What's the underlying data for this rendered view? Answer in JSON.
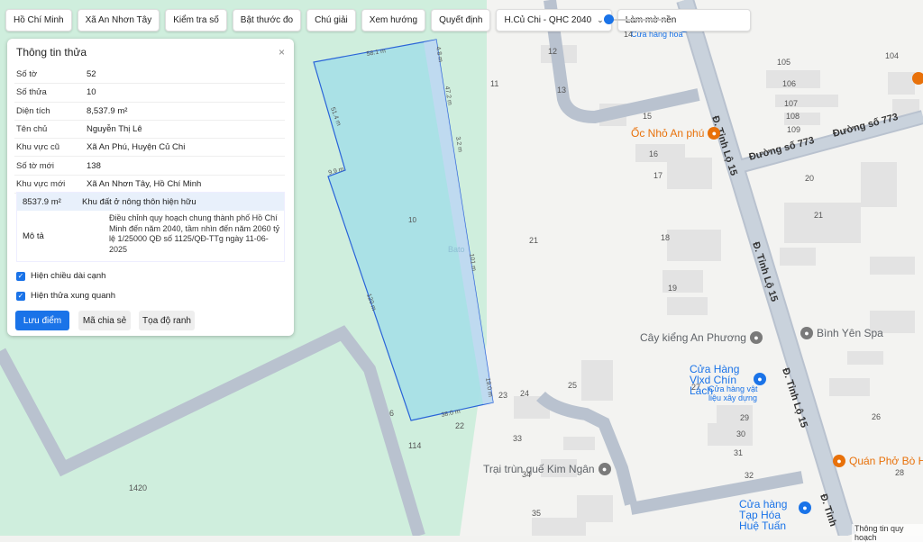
{
  "toolbar": {
    "items": [
      {
        "label": "Hồ Chí Minh"
      },
      {
        "label": "Xã An Nhơn Tây"
      },
      {
        "label": "Kiểm tra số"
      },
      {
        "label": "Bật thước đo"
      },
      {
        "label": "Chú giải"
      },
      {
        "label": "Xem hướng"
      },
      {
        "label": "Quyết định"
      },
      {
        "label": "H.Củ Chi - QHC 2040"
      },
      {
        "label": "Làm mờ nền"
      }
    ]
  },
  "panel": {
    "title": "Thông tin thửa",
    "close": "×",
    "rows": [
      {
        "key": "Số tờ",
        "value": "52"
      },
      {
        "key": "Số thửa",
        "value": "10"
      },
      {
        "key": "Diện tích",
        "value": "8,537.9 m²"
      },
      {
        "key": "Tên chủ",
        "value": "Nguyễn Thị Lê"
      },
      {
        "key": "Khu vực cũ",
        "value": "Xã An Phú, Huyện Củ Chi"
      },
      {
        "key": "Số tờ mới",
        "value": "138"
      },
      {
        "key": "Khu vực mới",
        "value": "Xã An Nhơn Tây, Hồ Chí Minh"
      }
    ],
    "land": {
      "area": "8537.9 m²",
      "type": "Khu đất ở nông thôn hiện hữu",
      "desc_label": "Mô tả",
      "desc": "Điều chỉnh quy hoạch chung thành phố Hồ Chí Minh đến năm 2040, tầm nhìn đến năm 2060 tỷ lệ 1/25000 QĐ số 1125/QĐ-TTg ngày 11-06-2025"
    },
    "checks": [
      {
        "label": "Hiện chiều dài cạnh"
      },
      {
        "label": "Hiện thửa xung quanh"
      }
    ],
    "buttons": {
      "save": "Lưu điểm",
      "share": "Mã chia sẻ",
      "coords": "Tọa độ ranh"
    }
  },
  "map": {
    "parcel_number": "10",
    "edges": [
      "58.1 m",
      "4.8 m",
      "47.2 m",
      "3.2 m",
      "51.4 m",
      "9.9 m",
      "101 m",
      "120 m",
      "19.0 m",
      "38.0 m"
    ],
    "parcel_labels": [
      "12",
      "11",
      "13",
      "14",
      "15",
      "16",
      "17",
      "18",
      "19",
      "20",
      "21",
      "21",
      "22",
      "23",
      "24",
      "25",
      "26",
      "27",
      "28",
      "29",
      "30",
      "31",
      "32",
      "33",
      "34",
      "35",
      "104",
      "105",
      "106",
      "107",
      "108",
      "109",
      "114",
      "1420",
      "6"
    ],
    "roads": [
      "Đường số 773",
      "Đường số 773",
      "Đ. Tỉnh Lộ 15",
      "Đ. Tỉnh Lộ 15",
      "Đ. Tỉnh Lộ 15",
      "Đ. Tỉnh"
    ],
    "pois": [
      {
        "name": "Ốc Nhỏ An phú"
      },
      {
        "name": "Cây kiểng An Phương"
      },
      {
        "name": "Bình Yên Spa"
      },
      {
        "name": "Cửa Hàng Vlxd Chín Lách"
      },
      {
        "name": "Quán Phở Bò Hà N"
      },
      {
        "name": "Trại trùn quế Kim Ngân"
      },
      {
        "name": "Cửa hàng Tạp Hóa Huệ Tuấn"
      },
      {
        "name": "Thông tin quy hoạch"
      }
    ],
    "poi_subs": [
      "Cửa hàng hoa",
      "Cửa hàng vật liệu xây dựng",
      "h"
    ],
    "watermark": "Bato"
  },
  "colors": {
    "accent": "#1a73e8",
    "parcel_fill": "#a8dfe6",
    "parcel_stroke": "#2a64d8",
    "green_area": "#cdeedc"
  }
}
